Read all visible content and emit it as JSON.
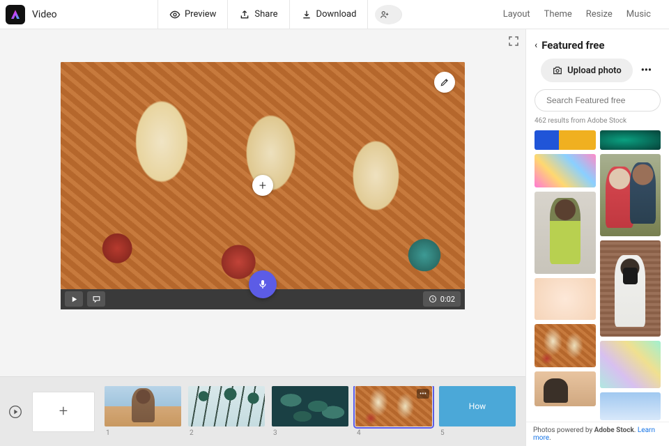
{
  "doc_title": "Video",
  "top": {
    "preview": "Preview",
    "share": "Share",
    "download": "Download"
  },
  "top_right": {
    "layout": "Layout",
    "theme": "Theme",
    "resize": "Resize",
    "music": "Music"
  },
  "canvas": {
    "duration": "0:02"
  },
  "timeline": {
    "clip5_text": "How",
    "numbers": [
      "1",
      "2",
      "3",
      "4",
      "5"
    ]
  },
  "sidebar": {
    "title": "Featured free",
    "upload_label": "Upload photo",
    "more_label": "•••",
    "search_placeholder": "Search Featured free",
    "results_meta": "462 results from Adobe Stock",
    "footer_prefix": "Photos powered by ",
    "footer_brand": "Adobe Stock",
    "footer_link": "Learn more"
  }
}
